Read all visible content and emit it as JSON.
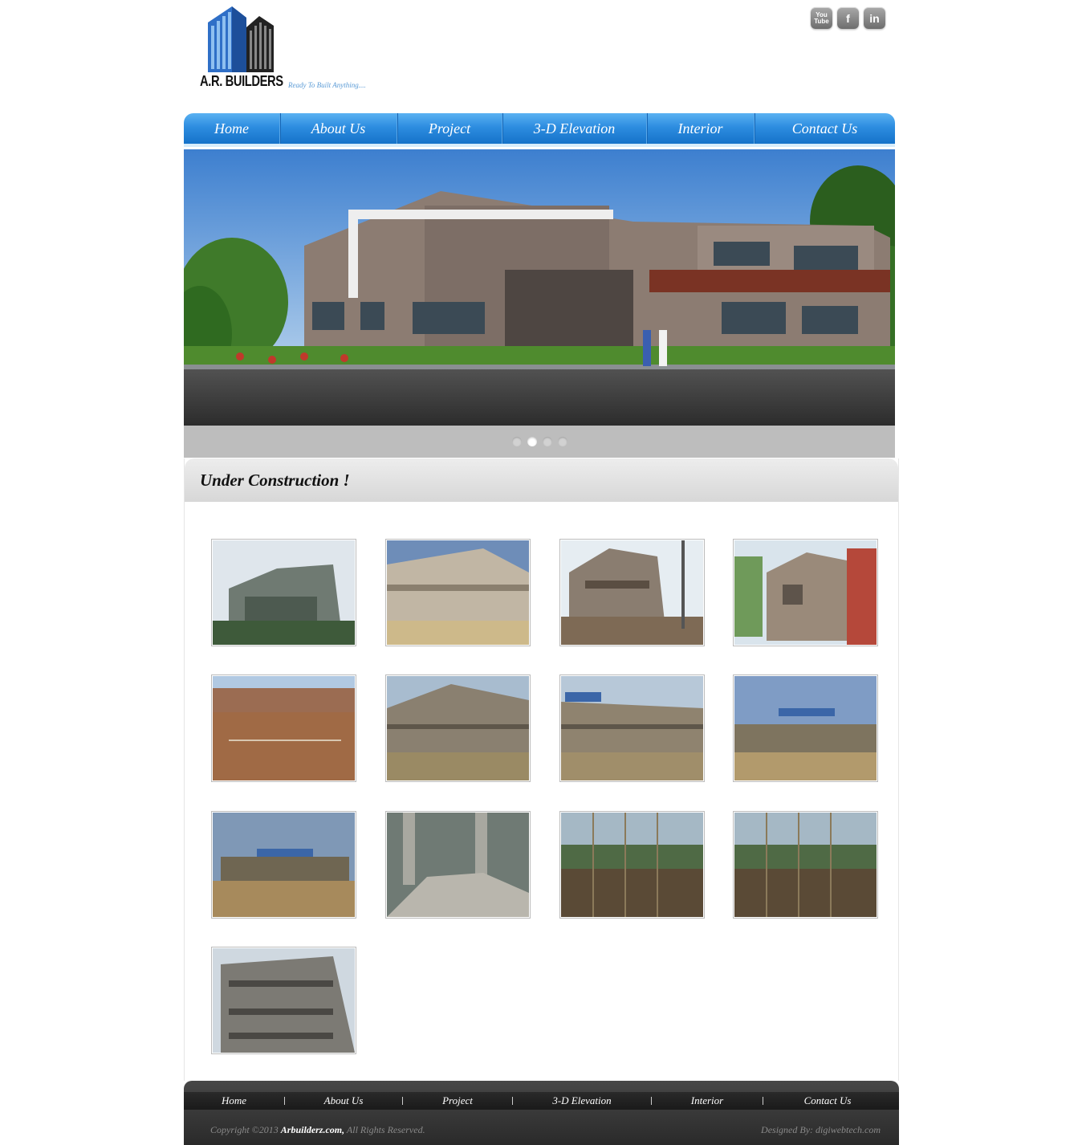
{
  "header": {
    "brand": "A.R. BUILDERS",
    "tagline": "Ready To Built Anything....",
    "social": [
      {
        "name": "youtube-icon",
        "label": "You Tube"
      },
      {
        "name": "facebook-icon",
        "label": "f"
      },
      {
        "name": "linkedin-icon",
        "label": "in"
      }
    ]
  },
  "nav": {
    "items": [
      "Home",
      "About Us",
      "Project",
      "3-D Elevation",
      "Interior",
      "Contact Us"
    ]
  },
  "slider": {
    "dots": 4,
    "active_index": 1
  },
  "main": {
    "title": "Under Construction !"
  },
  "footer": {
    "nav": [
      "Home",
      "About Us",
      "Project",
      "3-D Elevation",
      "Interior",
      "Contact Us"
    ],
    "copyright_prefix": "Copyright ©2013 ",
    "copyright_site": "Arbuilderz.com,",
    "copyright_suffix": " All Rights Reserved.",
    "designed_by": "Designed By: digiwebtech.com"
  },
  "colors": {
    "nav_blue": "#2d8de0",
    "footer_dark": "#2a2a2a"
  }
}
